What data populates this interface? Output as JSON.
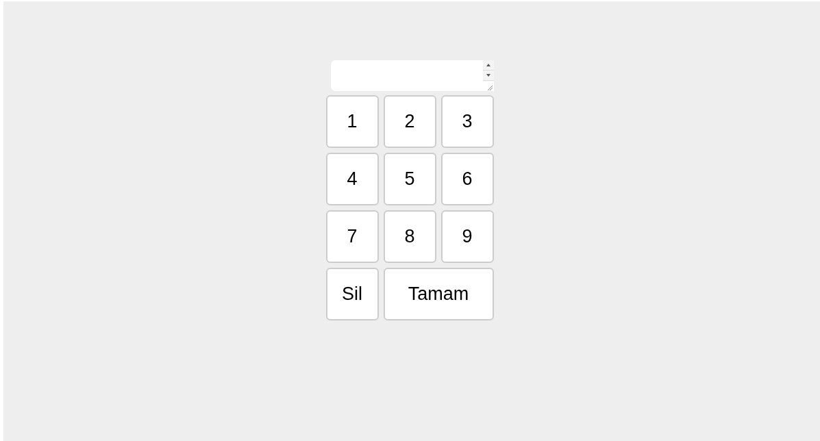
{
  "keys": [
    {
      "label": "1",
      "kind": "normal"
    },
    {
      "label": "2",
      "kind": "normal"
    },
    {
      "label": "3",
      "kind": "normal"
    },
    {
      "label": "4",
      "kind": "normal"
    },
    {
      "label": "5",
      "kind": "normal"
    },
    {
      "label": "6",
      "kind": "normal"
    },
    {
      "label": "7",
      "kind": "normal"
    },
    {
      "label": "8",
      "kind": "normal"
    },
    {
      "label": "9",
      "kind": "normal"
    },
    {
      "label": "Sil",
      "kind": "normal"
    },
    {
      "label": "Tamam",
      "kind": "wide"
    }
  ]
}
